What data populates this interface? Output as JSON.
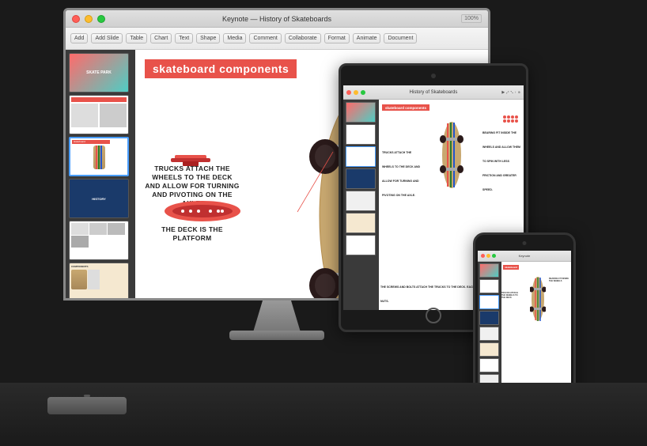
{
  "app": {
    "title": "History of Skateboards",
    "window_title": "Keynote — History of Skateboards",
    "zoom": "100%"
  },
  "monitor": {
    "traffic_lights": [
      "red",
      "yellow",
      "green"
    ]
  },
  "toolbar": {
    "buttons": [
      "Add",
      "Add Slide",
      "Table",
      "Chart",
      "Text",
      "Shape",
      "Media",
      "Comment",
      "Collaborate",
      "Format",
      "Animate",
      "Document"
    ]
  },
  "slide": {
    "title": "skateboard components",
    "annotations": {
      "trucks": "TRUCKS ATTACH THE WHEELS TO THE DECK AND ALLOW FOR TURNING AND PIVOTING ON THE AXLE.",
      "bearings": "BEARINGS FIT INSIDE THE WHEELS AND ALLOW THEM TO SPIN WITH LESS FRICTION AND GREATER SPEED.",
      "deck": "THE DECK IS THE PLATFORM",
      "screws": "THE SCREWS AND BOLTS ATTACH THE TRUCKS TO THE DECK. EACH SET IS SETS OF 4 BOLTS AND 4 NUTS."
    }
  },
  "tablet": {
    "title": "History of Skateboards",
    "slide_title": "skateboard components"
  },
  "phone": {
    "title": "Keynote"
  },
  "colors": {
    "accent_red": "#e8524a",
    "active_blue": "#4a9eff",
    "text_dark": "#222222",
    "bg_white": "#ffffff",
    "panel_dark": "#3a3a3a"
  }
}
